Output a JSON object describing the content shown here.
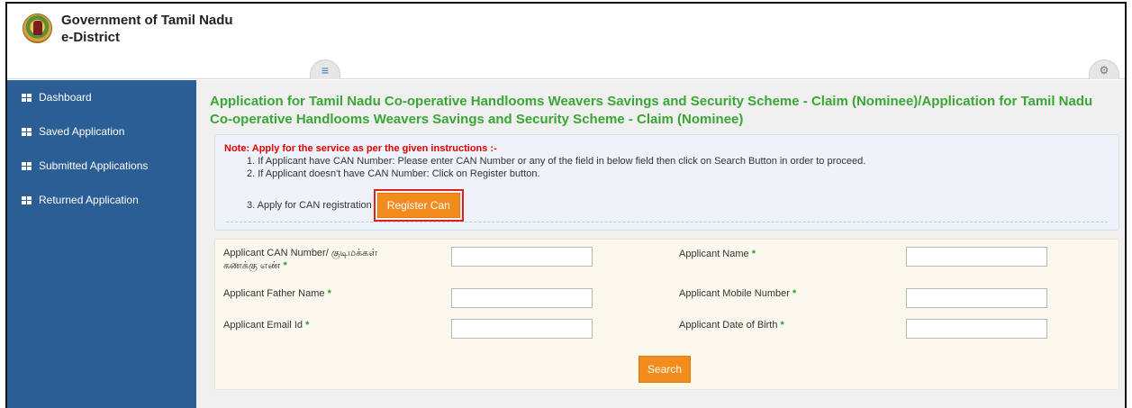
{
  "header": {
    "brand_line1": "Government of Tamil Nadu",
    "brand_line2": "e-District",
    "menu_icon": "≡",
    "settings_icon": "⚙"
  },
  "sidebar": {
    "items": [
      {
        "label": "Dashboard"
      },
      {
        "label": "Saved Application"
      },
      {
        "label": "Submitted Applications"
      },
      {
        "label": "Returned Application"
      }
    ]
  },
  "main": {
    "title": "Application for Tamil Nadu Co-operative Handlooms Weavers Savings and Security Scheme - Claim (Nominee)/Application for Tamil Nadu Co-operative Handlooms Weavers Savings and Security Scheme - Claim (Nominee)",
    "note": {
      "title": "Note: Apply for the service as per the given instructions :-",
      "line1": "1. If Applicant have CAN Number: Please enter CAN Number or any of the field in below field then click on Search Button in order to proceed.",
      "line2": "2. If Applicant doesn't have CAN Number: Click on Register button.",
      "line3": "3. Apply for CAN registration",
      "register_button": "Register Can"
    },
    "form": {
      "can_label_1": "Applicant CAN Number/ குடிமக்கள்",
      "can_label_2": "கணக்கு எண்",
      "name_label": "Applicant Name",
      "father_label": "Applicant Father Name",
      "mobile_label": "Applicant Mobile Number",
      "email_label": "Applicant Email Id",
      "dob_label": "Applicant Date of Birth",
      "required_mark": "*",
      "search_button": "Search"
    }
  },
  "colors": {
    "sidebar_bg": "#2a5e94",
    "title_green": "#3aa635",
    "button_orange": "#f28c1c",
    "note_red": "#e00000",
    "highlight_red": "#e02020"
  }
}
